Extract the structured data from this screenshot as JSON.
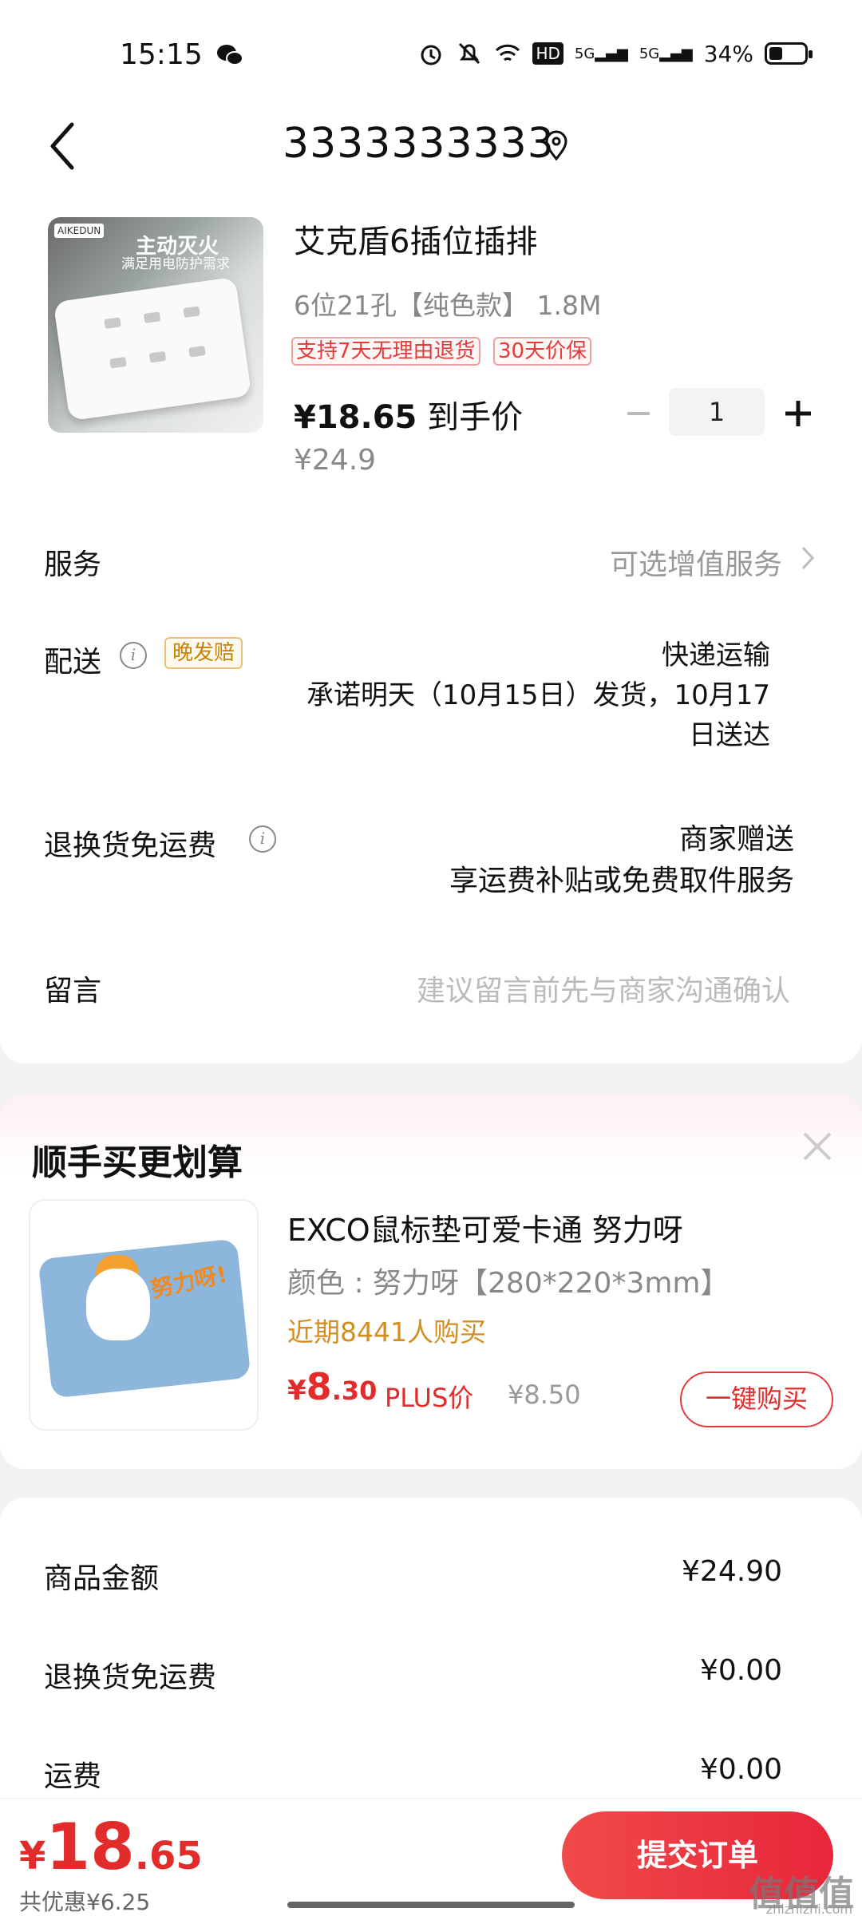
{
  "status_bar": {
    "time": "15:15",
    "battery": "34%",
    "network1": "5G",
    "network2": "5G",
    "hd": "HD"
  },
  "header": {
    "title": "3333333333"
  },
  "product": {
    "image_text_1": "主动灭火",
    "image_text_2": "满足用电防护需求",
    "image_logo": "AIKEDUN",
    "name": "艾克盾6插位插排",
    "spec": "6位21孔【纯色款】 1.8M",
    "tag_return": "支持7天无理由退货",
    "tag_price_protect": "30天价保",
    "price": "¥18.65",
    "price_suffix": " 到手价",
    "original_price": "¥24.9",
    "quantity": "1"
  },
  "service": {
    "label": "服务",
    "value": "可选增值服务"
  },
  "delivery": {
    "label": "配送",
    "badge": "晚发赔",
    "method": "快递运输",
    "promise_line1": "承诺明天（10月15日）发货，10月17",
    "promise_line2": "日送达"
  },
  "return_shipping": {
    "label": "退换货免运费",
    "line1": "商家赠送",
    "line2": "享运费补贴或免费取件服务"
  },
  "message": {
    "label": "留言",
    "placeholder": "建议留言前先与商家沟通确认"
  },
  "recommend": {
    "title": "顺手买更划算",
    "image_text": "努力呀!",
    "name": "EXCO鼠标垫可爱卡通 努力呀",
    "spec": "颜色 : 努力呀【280*220*3mm】",
    "buyers": "近期8441人购买",
    "price_symbol": "¥",
    "price_int": "8",
    "price_dec": ".30",
    "plus_label": "PLUS价",
    "old_price": "¥8.50",
    "buy_button": "一键购买"
  },
  "summary": {
    "rows": [
      {
        "label": "商品金额",
        "value": "¥24.90"
      },
      {
        "label": "退换货免运费",
        "value": "¥0.00"
      },
      {
        "label": "运费",
        "value": "¥0.00"
      }
    ]
  },
  "bottom": {
    "total_symbol": "¥",
    "total_int": "18",
    "total_dec": ".65",
    "saved": "共优惠¥6.25",
    "submit": "提交订单"
  },
  "watermark": {
    "text": "值值值",
    "sub": "zhizhizhi.com"
  },
  "colors": {
    "accent_red": "#e22c2c",
    "orange": "#d48d1f",
    "grey_text": "#888888"
  }
}
